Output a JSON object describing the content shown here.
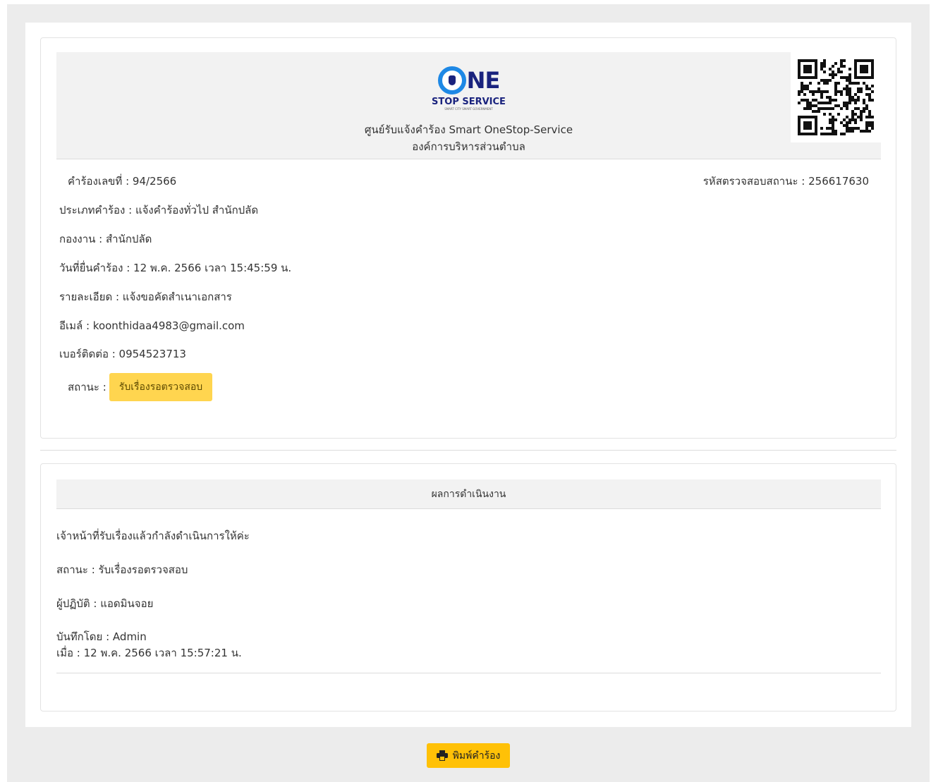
{
  "header": {
    "logo_main": "NE",
    "logo_sub": "STOP SERVICE",
    "logo_tagline": "SMART CITY SMART GOVERNMENT",
    "title": "ศูนย์รับแจ้งคำร้อง Smart OneStop-Service",
    "subtitle": "องค์การบริหารส่วนตำบล"
  },
  "request": {
    "number_label": "คำร้องเลขที่ : 94/2566",
    "tracking_label": "รหัสตรวจสอบสถานะ : 256617630",
    "type": "ประเภทคำร้อง : แจ้งคำร้องทั่วไป สำนักปลัด",
    "division": "กองงาน : สำนักปลัด",
    "date": "วันที่ยื่นคำร้อง : 12 พ.ค. 2566 เวลา 15:45:59 น.",
    "detail": "รายละเอียด : แจ้งขอคัดสำเนาเอกสาร",
    "email": "อีเมล์ : koonthidaa4983@gmail.com",
    "phone": "เบอร์ติดต่อ : 0954523713",
    "status_label": "สถานะ :",
    "status_value": "รับเรื่องรอตรวจสอบ"
  },
  "result": {
    "heading": "ผลการดำเนินงาน",
    "message": "เจ้าหน้าที่รับเรื่องแล้วกำลังดำเนินการให้ค่ะ",
    "status": "สถานะ : รับเรื่องรอตรวจสอบ",
    "operator": "ผู้ปฏิบัติ : แอดมินจอย",
    "recorded_by": "บันทึกโดย : Admin",
    "recorded_at": "เมื่อ : 12 พ.ค. 2566 เวลา 15:57:21 น."
  },
  "actions": {
    "print_label": "พิมพ์คำร้อง",
    "print_icon": "printer-icon"
  },
  "colors": {
    "badge": "#ffd54f",
    "print_button": "#ffc107",
    "logo_blue": "#1a237e"
  }
}
